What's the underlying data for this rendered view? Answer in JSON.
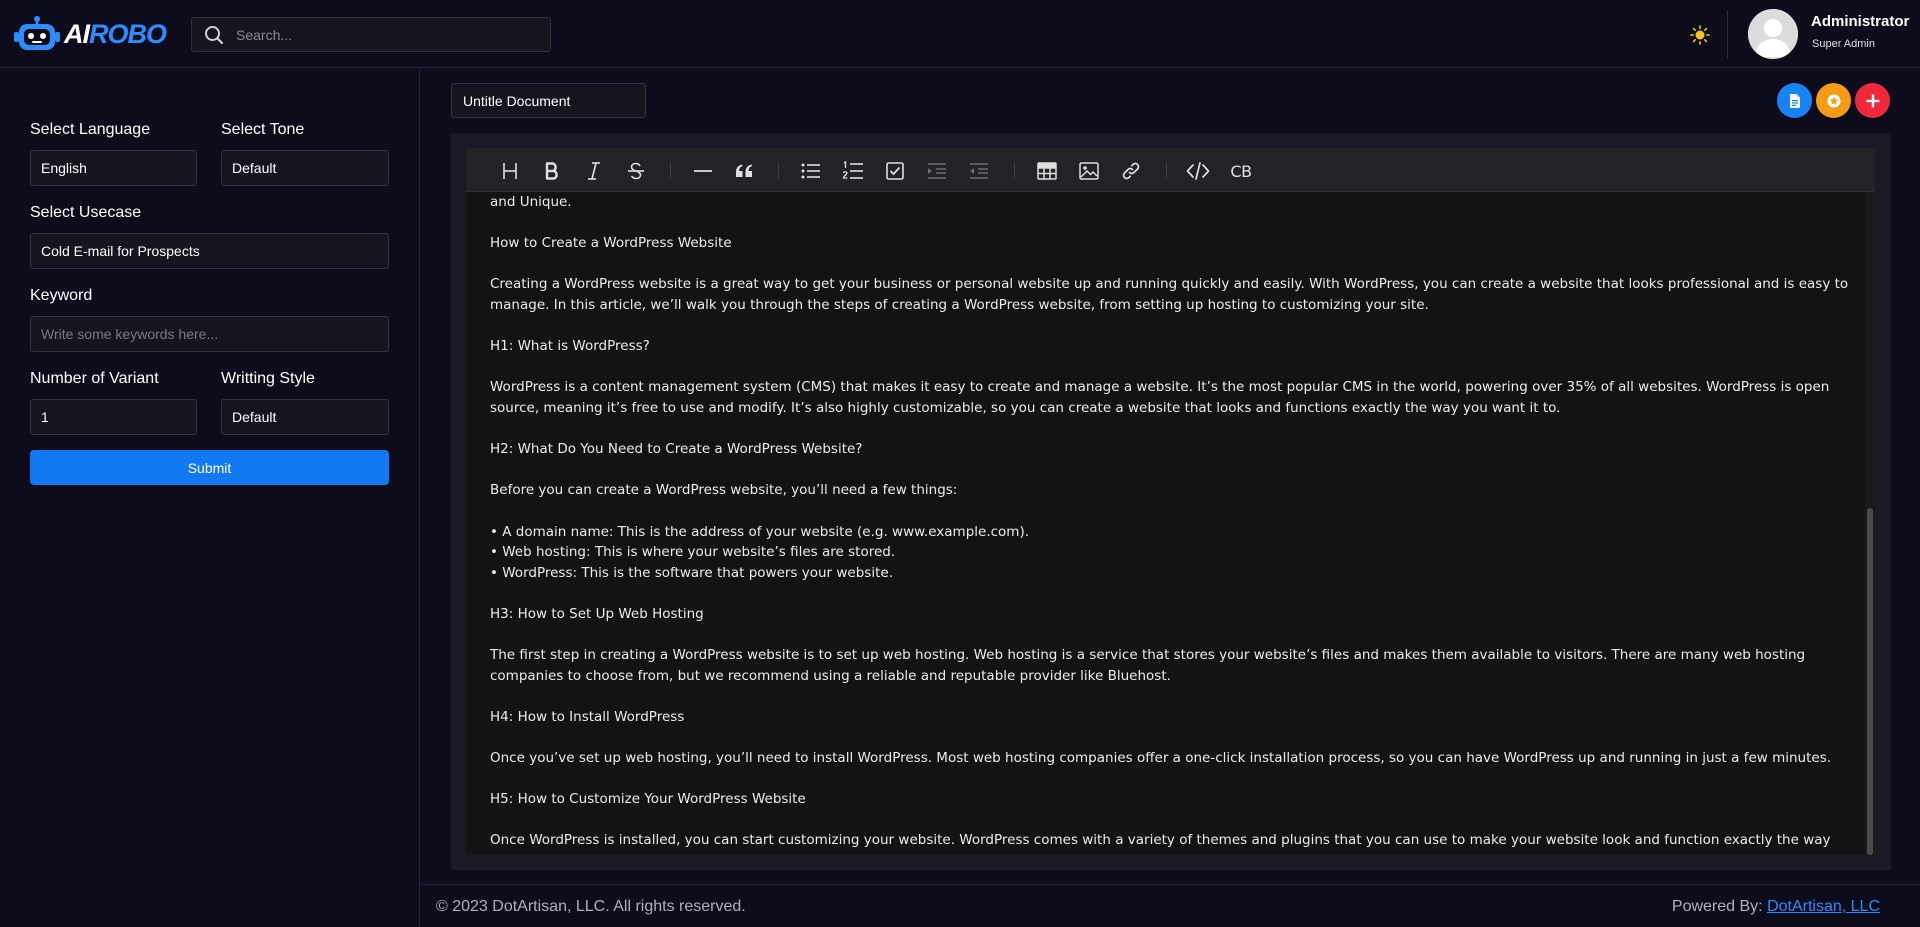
{
  "header": {
    "logo": {
      "ai": "AI",
      "robo": "ROBO"
    },
    "search_placeholder": "Search...",
    "user": {
      "name": "Administrator",
      "role": "Super Admin"
    },
    "icons": [
      "robot-logo-icon",
      "search-icon",
      "sun-icon",
      "avatar-icon"
    ]
  },
  "sidebar": {
    "language": {
      "label": "Select Language",
      "value": "English"
    },
    "tone": {
      "label": "Select Tone",
      "value": "Default"
    },
    "usecase": {
      "label": "Select Usecase",
      "value": "Cold E-mail for Prospects"
    },
    "keyword": {
      "label": "Keyword",
      "placeholder": "Write some keywords here..."
    },
    "variant": {
      "label": "Number of Variant",
      "value": "1"
    },
    "style": {
      "label": "Writting Style",
      "value": "Default"
    },
    "submit_label": "Submit"
  },
  "document": {
    "title_value": "Untitle Document",
    "actions": [
      "document-icon",
      "star-icon",
      "plus-icon"
    ]
  },
  "toolbar": {
    "buttons": [
      "heading",
      "bold",
      "italic",
      "strikethrough",
      "horizontal-rule",
      "quote",
      "bullet-list",
      "ordered-list",
      "task-list",
      "indent",
      "outdent",
      "table",
      "image",
      "link",
      "code",
      "code-block"
    ],
    "codeblock_label": "CB"
  },
  "editor": {
    "lines": [
      "and Unique.",
      "",
      "How to Create a WordPress Website",
      "",
      "Creating a WordPress website is a great way to get your business or personal website up and running quickly and easily. With WordPress, you can create a website that looks professional and is easy to manage. In this article, we’ll walk you through the steps of creating a WordPress website, from setting up hosting to customizing your site.",
      "",
      "H1: What is WordPress?",
      "",
      "WordPress is a content management system (CMS) that makes it easy to create and manage a website. It’s the most popular CMS in the world, powering over 35% of all websites. WordPress is open source, meaning it’s free to use and modify. It’s also highly customizable, so you can create a website that looks and functions exactly the way you want it to.",
      "",
      "H2: What Do You Need to Create a WordPress Website?",
      "",
      "Before you can create a WordPress website, you’ll need a few things:",
      "",
      "• A domain name: This is the address of your website (e.g. www.example.com).",
      "• Web hosting: This is where your website’s files are stored.",
      "• WordPress: This is the software that powers your website.",
      "",
      "H3: How to Set Up Web Hosting",
      "",
      "The first step in creating a WordPress website is to set up web hosting. Web hosting is a service that stores your website’s files and makes them available to visitors. There are many web hosting companies to choose from, but we recommend using a reliable and reputable provider like Bluehost.",
      "",
      "H4: How to Install WordPress",
      "",
      "Once you’ve set up web hosting, you’ll need to install WordPress. Most web hosting companies offer a one-click installation process, so you can have WordPress up and running in just a few minutes.",
      "",
      "H5: How to Customize Your WordPress Website",
      "",
      "Once WordPress is installed, you can start customizing your website. WordPress comes with a variety of themes and plugins that you can use to make your website look and function exactly the way you want it to."
    ]
  },
  "footer": {
    "copyright": "© 2023 DotArtisan, LLC. All rights reserved.",
    "powered_prefix": "Powered By: ",
    "powered_link": "DotArtisan, LLC"
  },
  "colors": {
    "background": "#0c0c1c",
    "accent": "#1279f2",
    "fab_doc": "#1783f5",
    "fab_star": "#f59b16",
    "fab_add": "#f0283c",
    "sun": "#f5c518"
  }
}
